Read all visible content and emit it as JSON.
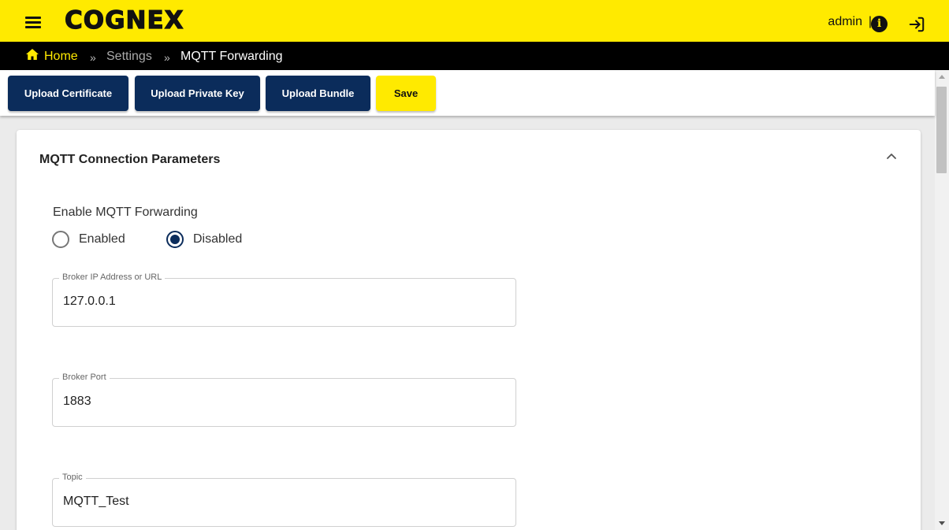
{
  "header": {
    "logo_text": "COGNEX",
    "user": "admin",
    "user_separator": "|",
    "brand_color": "#ffea00",
    "icons": [
      "menu-icon",
      "info-icon",
      "logout-icon"
    ]
  },
  "breadcrumb": {
    "home": "Home",
    "separator": "»",
    "settings": "Settings",
    "current": "MQTT Forwarding"
  },
  "toolbar": {
    "upload_certificate": "Upload Certificate",
    "upload_private_key": "Upload Private Key",
    "upload_bundle": "Upload Bundle",
    "save": "Save",
    "primary_color": "#0b2c5b"
  },
  "panel": {
    "title": "MQTT Connection Parameters",
    "expanded": true,
    "enable_label": "Enable MQTT Forwarding",
    "options": [
      {
        "label": "Enabled",
        "checked": false
      },
      {
        "label": "Disabled",
        "checked": true
      }
    ],
    "fields": {
      "broker": {
        "label": "Broker IP Address or URL",
        "value": "127.0.0.1"
      },
      "port": {
        "label": "Broker Port",
        "value": "1883"
      },
      "topic": {
        "label": "Topic",
        "value": "MQTT_Test"
      }
    }
  }
}
